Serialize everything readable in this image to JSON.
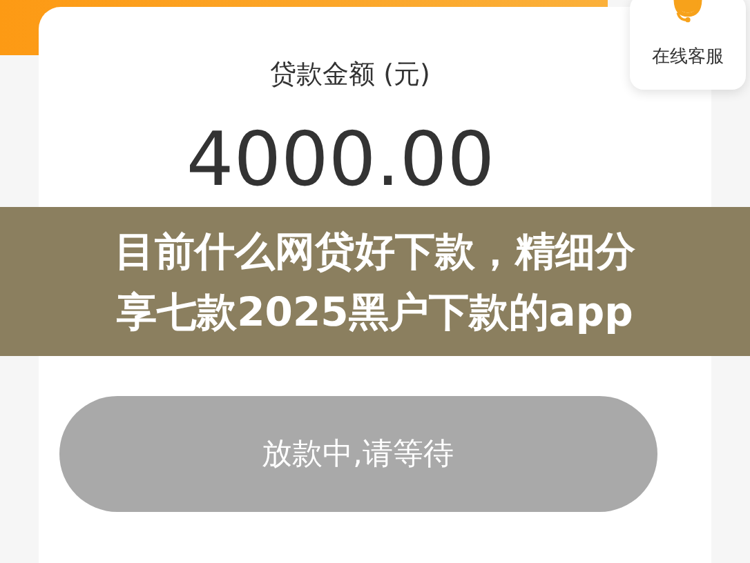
{
  "loan_card": {
    "label": "贷款金额 (元)",
    "amount": "4000.00"
  },
  "customer_service": {
    "label": "在线客服"
  },
  "submit_button": {
    "label": "放款中,请等待",
    "disabled": true
  },
  "overlay_title": {
    "lines": [
      "目前什么网贷好下款，精细分",
      "享七款2025黑户下款的app"
    ]
  }
}
